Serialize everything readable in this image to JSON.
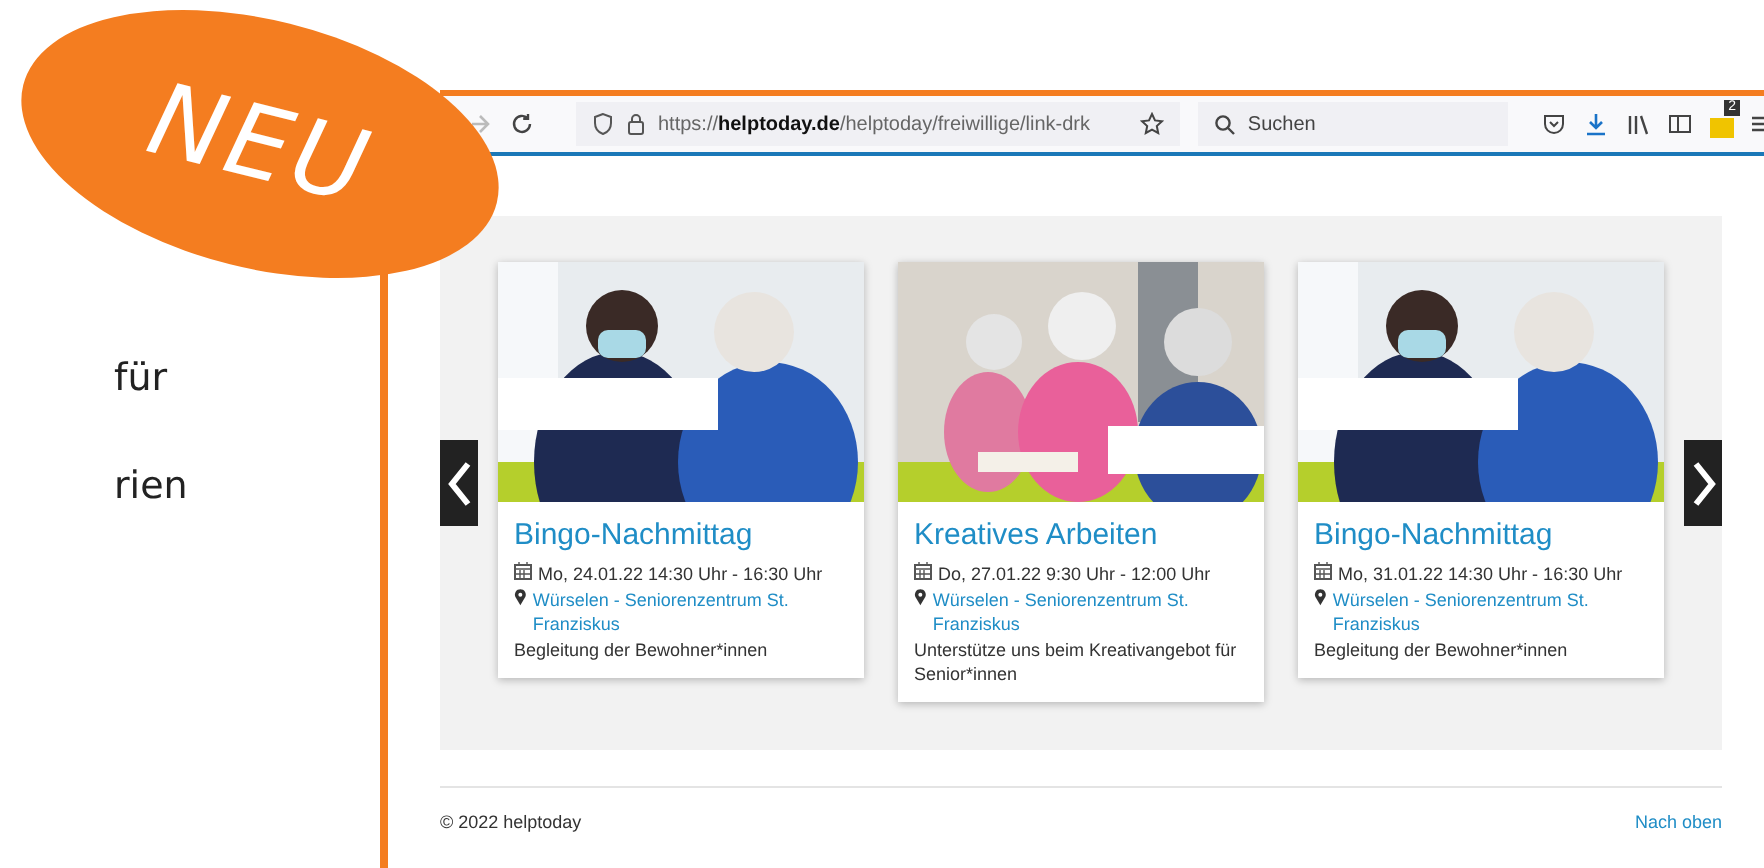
{
  "badge": {
    "text": "NEU"
  },
  "side_text": [
    "für",
    "rien"
  ],
  "browser": {
    "url": "https://**helptoday.de**/helptoday/freiwillige/link-drk",
    "search": {
      "placeholder": "Suchen"
    },
    "extension_badge": "2"
  },
  "cards": [
    {
      "title": "Bingo-Nachmittag",
      "date": "Mo, 24.01.22  14:30 Uhr - 16:30 Uhr",
      "location": "Würselen - Seniorenzentrum St. Franziskus",
      "description": "Begleitung der Bewohner*innen"
    },
    {
      "title": "Kreatives Arbeiten",
      "date": "Do, 27.01.22  9:30 Uhr - 12:00 Uhr",
      "location": "Würselen - Seniorenzentrum St. Franziskus",
      "description": "Unterstütze uns beim Kreativangebot für Senior*innen"
    },
    {
      "title": "Bingo-Nachmittag",
      "date": "Mo, 31.01.22  14:30 Uhr - 16:30 Uhr",
      "location": "Würselen - Seniorenzentrum St. Franziskus",
      "description": "Begleitung der Bewohner*innen"
    }
  ],
  "footer": {
    "copyright": "© 2022 helptoday",
    "back_to_top": "Nach oben"
  }
}
